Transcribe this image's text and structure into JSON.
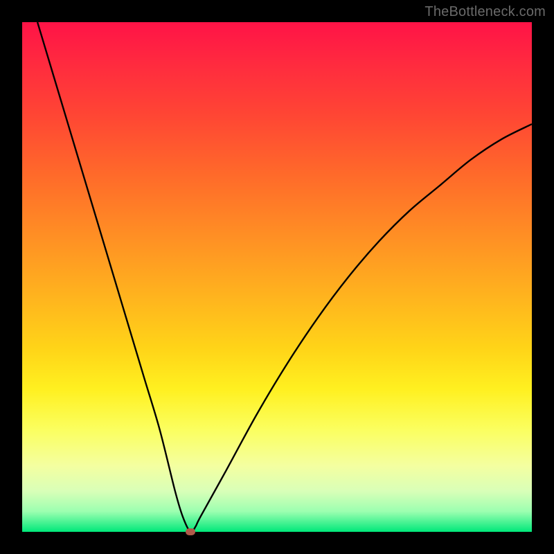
{
  "watermark": "TheBottleneck.com",
  "chart_data": {
    "type": "line",
    "title": "",
    "xlabel": "",
    "ylabel": "",
    "xlim": [
      0,
      100
    ],
    "ylim": [
      0,
      100
    ],
    "grid": false,
    "series": [
      {
        "name": "bottleneck-curve",
        "x": [
          3,
          6,
          9,
          12,
          15,
          18,
          21,
          24,
          27,
          30,
          31.5,
          33,
          34,
          35,
          40,
          46,
          52,
          58,
          64,
          70,
          76,
          82,
          88,
          94,
          100
        ],
        "y": [
          100,
          90,
          80,
          70,
          60,
          50,
          40,
          30,
          20,
          8,
          3,
          0,
          1,
          3,
          12,
          23,
          33,
          42,
          50,
          57,
          63,
          68,
          73,
          77,
          80
        ]
      }
    ],
    "marker": {
      "x": 33,
      "y": 0,
      "color": "#b05a4a"
    },
    "background_gradient": {
      "top": "#ff1347",
      "mid": "#ffd418",
      "bottom": "#00e87a"
    }
  }
}
